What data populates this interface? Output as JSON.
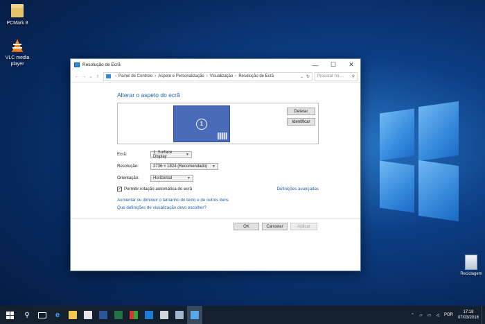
{
  "desktop": {
    "icons": [
      {
        "label": "PCMark 8",
        "icon": "folder-icon"
      },
      {
        "label": "VLC media player",
        "icon": "vlc-cone-icon"
      },
      {
        "label": "Reciclagem",
        "icon": "recycle-bin-icon"
      }
    ]
  },
  "window": {
    "title": "Resolução de Ecrã",
    "controls": {
      "minimize": "—",
      "maximize": "☐",
      "close": "✕"
    },
    "breadcrumb": [
      "Painel de Controlo",
      "Aspeto e Personalização",
      "Visualização",
      "Resolução de Ecrã"
    ],
    "search_placeholder": "Procurar no ...",
    "heading": "Alterar o aspeto do ecrã",
    "monitor_number": "1",
    "detect_label": "Detetar",
    "identify_label": "Identificar",
    "fields": {
      "display_label": "Ecrã:",
      "display_value": "1. Surface Display",
      "resolution_label": "Resolução:",
      "resolution_value": "2736 × 1824 (Recomendado)",
      "orientation_label": "Orientação:",
      "orientation_value": "Horizontal"
    },
    "auto_rotate_label": "Permitir rotação automática do ecrã",
    "auto_rotate_checked": true,
    "advanced_link": "Definições avançadas",
    "text_size_link": "Aumentar ou diminuir o tamanho do texto e de outros itens",
    "which_settings_link": "Que definições de visualização devo escolher?",
    "ok_label": "OK",
    "cancel_label": "Cancelar",
    "apply_label": "Aplicar"
  },
  "taskbar": {
    "language": "POR",
    "time": "17:18",
    "date": "07/03/2016"
  },
  "colors": {
    "accent": "#1e5fa8",
    "taskbar": "#14202e",
    "monitor": "#4a6bb8"
  }
}
